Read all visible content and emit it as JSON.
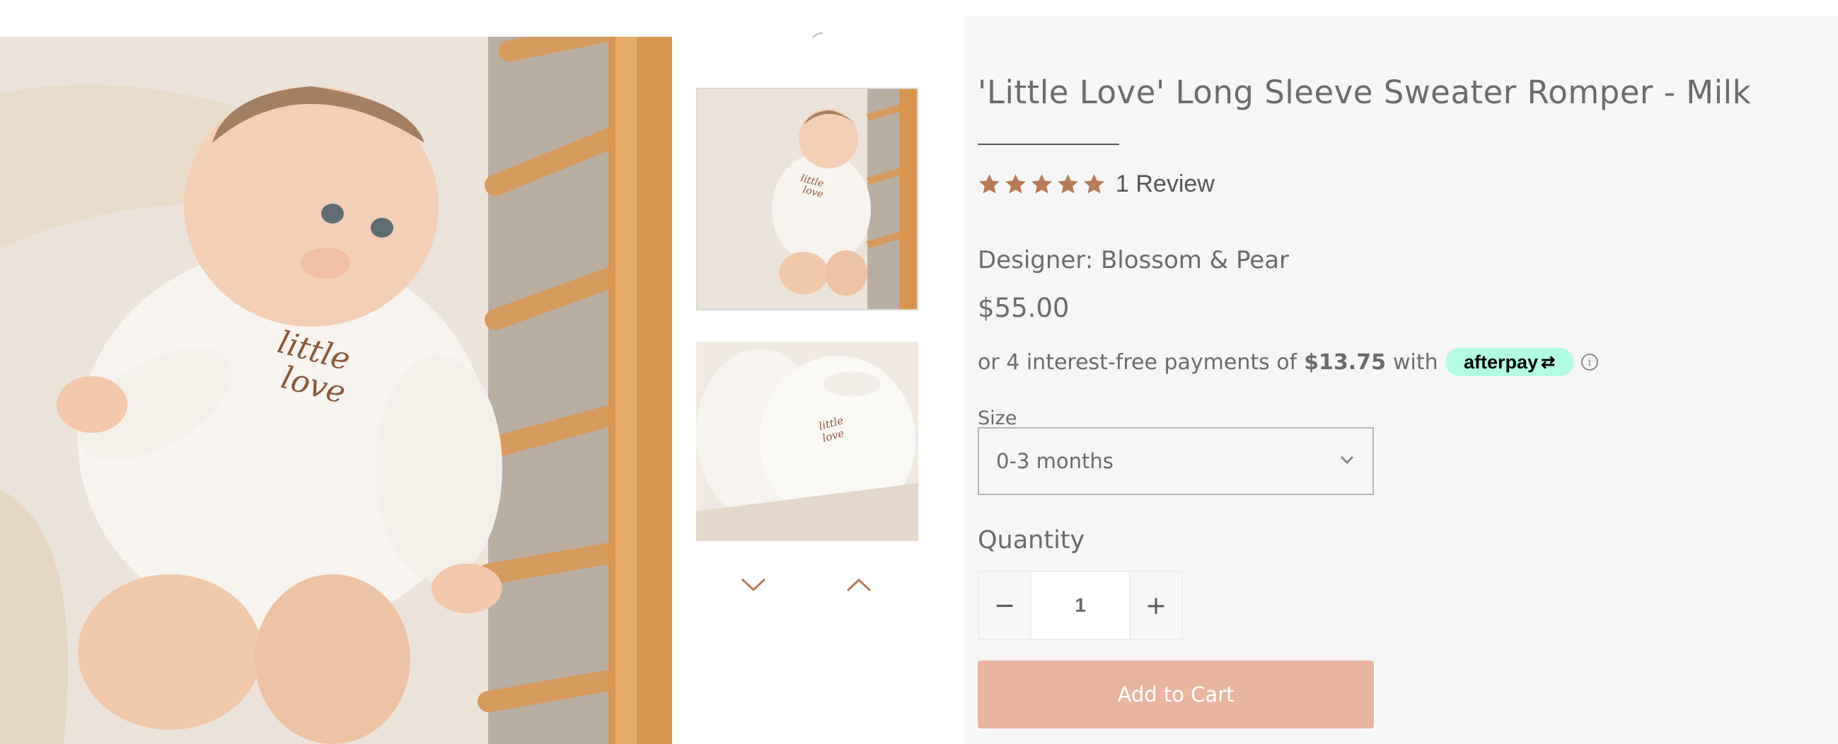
{
  "product": {
    "title": "'Little Love' Long Sleeve Sweater Romper - Milk",
    "rating_value": 5,
    "rating_max": 5,
    "review_count_label": "1 Review",
    "designer_label": "Designer: Blossom & Pear",
    "price": "$55.00"
  },
  "afterpay": {
    "prefix": "or 4 interest-free payments of",
    "amount": "$13.75",
    "suffix": "with",
    "brand": "afterpay",
    "info_glyph": "i"
  },
  "size": {
    "label": "Size",
    "selected": "0-3 months"
  },
  "quantity": {
    "label": "Quantity",
    "value": "1",
    "decrement": "−",
    "increment": "+"
  },
  "cart": {
    "add_label": "Add to Cart"
  },
  "colors": {
    "accent_brown": "#b97a58",
    "add_to_cart_bg": "#e9b5a1",
    "afterpay_mint": "#b2fce4",
    "panel_bg": "#f6f6f6"
  },
  "icons": {
    "star": "star-icon",
    "chevron_down": "chevron-down-icon",
    "thumb_prev": "chevron-down-icon",
    "thumb_next": "chevron-up-icon",
    "info": "info-icon"
  }
}
